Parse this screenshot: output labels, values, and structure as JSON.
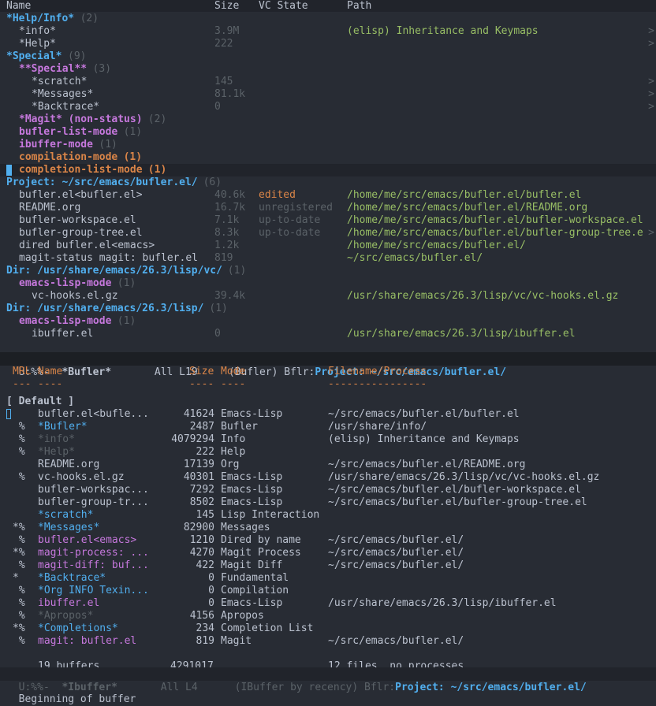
{
  "bufler": {
    "columns": [
      "Name",
      "Size",
      "VC State",
      "Path"
    ],
    "rows": [
      {
        "kind": "group",
        "indent": 0,
        "cls": "grp1",
        "name": "*Help/Info*",
        "count": "(2)"
      },
      {
        "kind": "item",
        "indent": 1,
        "name": "*info*",
        "size": "3.9M",
        "vc": "",
        "path": "(elisp) Inheritance and Keymaps",
        "namecls": "",
        "pathcls": "green",
        "arrow": ">"
      },
      {
        "kind": "item",
        "indent": 1,
        "name": "*Help*",
        "size": "222",
        "vc": "",
        "path": "",
        "namecls": "",
        "pathcls": "",
        "arrow": ">"
      },
      {
        "kind": "group",
        "indent": 0,
        "cls": "grp1",
        "name": "*Special*",
        "count": "(9)"
      },
      {
        "kind": "group",
        "indent": 1,
        "cls": "grp2",
        "name": "**Special**",
        "count": "(3)"
      },
      {
        "kind": "item",
        "indent": 2,
        "name": "*scratch*",
        "size": "145",
        "vc": "",
        "path": "",
        "namecls": "",
        "pathcls": "",
        "arrow": ">"
      },
      {
        "kind": "item",
        "indent": 2,
        "name": "*Messages*",
        "size": "81.1k",
        "vc": "",
        "path": "",
        "namecls": "",
        "pathcls": "",
        "arrow": ">"
      },
      {
        "kind": "item",
        "indent": 2,
        "name": "*Backtrace*",
        "size": "0",
        "vc": "",
        "path": "",
        "namecls": "",
        "pathcls": "",
        "arrow": ">"
      },
      {
        "kind": "group",
        "indent": 1,
        "cls": "grp2",
        "name": "*Magit* (non-status)",
        "count": "(2)"
      },
      {
        "kind": "group",
        "indent": 1,
        "cls": "grp2",
        "name": "bufler-list-mode",
        "count": "(1)"
      },
      {
        "kind": "group",
        "indent": 1,
        "cls": "grp2",
        "name": "ibuffer-mode",
        "count": "(1)"
      },
      {
        "kind": "group",
        "indent": 1,
        "cls": "grp3",
        "name": "compilation-mode",
        "count": "(1)"
      },
      {
        "kind": "group",
        "indent": 1,
        "cls": "grp3",
        "name": "completion-list-mode",
        "count": "(1)",
        "selected": true
      },
      {
        "kind": "group",
        "indent": 0,
        "cls": "grp1",
        "name": "Project: ~/src/emacs/bufler.el/",
        "count": "(6)"
      },
      {
        "kind": "item",
        "indent": 1,
        "name": "bufler.el<bufler.el>",
        "size": "40.6k",
        "vc": "edited",
        "path": "/home/me/src/emacs/bufler.el/bufler.el",
        "namecls": "",
        "vccls": "orange",
        "pathcls": "green",
        "arrow": ""
      },
      {
        "kind": "item",
        "indent": 1,
        "name": "README.org",
        "size": "16.7k",
        "vc": "unregistered",
        "path": "/home/me/src/emacs/bufler.el/README.org",
        "namecls": "",
        "vccls": "gray",
        "pathcls": "green",
        "arrow": ""
      },
      {
        "kind": "item",
        "indent": 1,
        "name": "bufler-workspace.el",
        "size": "7.1k",
        "vc": "up-to-date",
        "path": "/home/me/src/emacs/bufler.el/bufler-workspace.el",
        "namecls": "",
        "vccls": "gray",
        "pathcls": "green",
        "arrow": ""
      },
      {
        "kind": "item",
        "indent": 1,
        "name": "bufler-group-tree.el",
        "size": "8.3k",
        "vc": "up-to-date",
        "path": "/home/me/src/emacs/bufler.el/bufler-group-tree.e",
        "namecls": "",
        "vccls": "gray",
        "pathcls": "green",
        "arrow": ">"
      },
      {
        "kind": "item",
        "indent": 1,
        "name": "dired bufler.el<emacs>",
        "size": "1.2k",
        "vc": "",
        "path": "/home/me/src/emacs/bufler.el/",
        "namecls": "",
        "pathcls": "green",
        "arrow": ""
      },
      {
        "kind": "item",
        "indent": 1,
        "name": "magit-status magit: bufler.el",
        "size": "819",
        "vc": "",
        "path": "~/src/emacs/bufler.el/",
        "namecls": "",
        "pathcls": "green",
        "arrow": ""
      },
      {
        "kind": "group",
        "indent": 0,
        "cls": "grp1",
        "name": "Dir: /usr/share/emacs/26.3/lisp/vc/",
        "count": "(1)"
      },
      {
        "kind": "group",
        "indent": 1,
        "cls": "grp2",
        "name": "emacs-lisp-mode",
        "count": "(1)"
      },
      {
        "kind": "item",
        "indent": 2,
        "name": "vc-hooks.el.gz",
        "size": "39.4k",
        "vc": "",
        "path": "/usr/share/emacs/26.3/lisp/vc/vc-hooks.el.gz",
        "namecls": "",
        "pathcls": "green",
        "arrow": ""
      },
      {
        "kind": "group",
        "indent": 0,
        "cls": "grp1",
        "name": "Dir: /usr/share/emacs/26.3/lisp/",
        "count": "(1)"
      },
      {
        "kind": "group",
        "indent": 1,
        "cls": "grp2",
        "name": "emacs-lisp-mode",
        "count": "(1)"
      },
      {
        "kind": "item",
        "indent": 2,
        "name": "ibuffer.el",
        "size": "0",
        "vc": "",
        "path": "/usr/share/emacs/26.3/lisp/ibuffer.el",
        "namecls": "",
        "pathcls": "green",
        "arrow": ""
      }
    ]
  },
  "modeline1": {
    "state": "U:%%-",
    "buffer": "*Bufler*",
    "pos": "All L19",
    "mode": "(Bufler) Bflr:",
    "project": "Project: ~/src/emacs/bufler.el/"
  },
  "ibuffer": {
    "header": {
      "mrl": "MRL",
      "name": "Name",
      "size": "Size",
      "mode": "Mode",
      "file": "Filename/Process"
    },
    "underline": {
      "mrl": "---",
      "name": "----",
      "size": "----",
      "mode": "----",
      "file": "----------------"
    },
    "group_title": "[ Default ]",
    "rows": [
      {
        "mrl": "",
        "name": "bufler.el<bufle...",
        "size": "41624",
        "mode": "Emacs-Lisp",
        "file": "~/src/emacs/bufler.el/bufler.el",
        "namecls": "",
        "cursor": true
      },
      {
        "mrl": " %",
        "name": "*Bufler*",
        "size": "2487",
        "mode": "Bufler",
        "file": "/usr/share/info/",
        "namecls": "blue"
      },
      {
        "mrl": " %",
        "name": "*info*",
        "size": "4079294",
        "mode": "Info",
        "file": "(elisp) Inheritance and Keymaps",
        "namecls": "gray"
      },
      {
        "mrl": " %",
        "name": "*Help*",
        "size": "222",
        "mode": "Help",
        "file": "",
        "namecls": "gray"
      },
      {
        "mrl": "",
        "name": "README.org",
        "size": "17139",
        "mode": "Org",
        "file": "~/src/emacs/bufler.el/README.org",
        "namecls": ""
      },
      {
        "mrl": " %",
        "name": "vc-hooks.el.gz",
        "size": "40301",
        "mode": "Emacs-Lisp",
        "file": "/usr/share/emacs/26.3/lisp/vc/vc-hooks.el.gz",
        "namecls": ""
      },
      {
        "mrl": "",
        "name": "bufler-workspac...",
        "size": "7292",
        "mode": "Emacs-Lisp",
        "file": "~/src/emacs/bufler.el/bufler-workspace.el",
        "namecls": ""
      },
      {
        "mrl": "",
        "name": "bufler-group-tr...",
        "size": "8502",
        "mode": "Emacs-Lisp",
        "file": "~/src/emacs/bufler.el/bufler-group-tree.el",
        "namecls": ""
      },
      {
        "mrl": "",
        "name": "*scratch*",
        "size": "145",
        "mode": "Lisp Interaction",
        "file": "",
        "namecls": "blue"
      },
      {
        "mrl": "*%",
        "name": "*Messages*",
        "size": "82900",
        "mode": "Messages",
        "file": "",
        "namecls": "blue"
      },
      {
        "mrl": " %",
        "name": "bufler.el<emacs>",
        "size": "1210",
        "mode": "Dired by name",
        "file": "~/src/emacs/bufler.el/",
        "namecls": "purple"
      },
      {
        "mrl": "*%",
        "name": "magit-process: ...",
        "size": "4270",
        "mode": "Magit Process",
        "file": "~/src/emacs/bufler.el/",
        "namecls": "purple"
      },
      {
        "mrl": " %",
        "name": "magit-diff: buf...",
        "size": "422",
        "mode": "Magit Diff",
        "file": "~/src/emacs/bufler.el/",
        "namecls": "purple"
      },
      {
        "mrl": "*",
        "name": "*Backtrace*",
        "size": "0",
        "mode": "Fundamental",
        "file": "",
        "namecls": "blue"
      },
      {
        "mrl": " %",
        "name": "*Org INFO Texin...",
        "size": "0",
        "mode": "Compilation",
        "file": "",
        "namecls": "blue"
      },
      {
        "mrl": " %",
        "name": "ibuffer.el",
        "size": "0",
        "mode": "Emacs-Lisp",
        "file": "/usr/share/emacs/26.3/lisp/ibuffer.el",
        "namecls": "purple"
      },
      {
        "mrl": " %",
        "name": "*Apropos*",
        "size": "4156",
        "mode": "Apropos",
        "file": "",
        "namecls": "gray"
      },
      {
        "mrl": "*%",
        "name": "*Completions*",
        "size": "234",
        "mode": "Completion List",
        "file": "",
        "namecls": "blue"
      },
      {
        "mrl": " %",
        "name": "magit: bufler.el",
        "size": "819",
        "mode": "Magit",
        "file": "~/src/emacs/bufler.el/",
        "namecls": "purple"
      }
    ],
    "summary": {
      "count": "19 buffers",
      "size": "4291017",
      "files": "12 files, no processes"
    }
  },
  "modeline2": {
    "state": "U:%%-",
    "buffer": "*Ibuffer*",
    "pos": "All L4",
    "mode": "(IBuffer by recency) Bflr:",
    "project": "Project: ~/src/emacs/bufler.el/"
  },
  "echo": "Beginning of buffer",
  "colors": {
    "bg": "#282c34",
    "blue": "#51afef",
    "purple": "#c678dd",
    "orange": "#da8548",
    "green": "#98be65",
    "gray": "#5b6268"
  }
}
